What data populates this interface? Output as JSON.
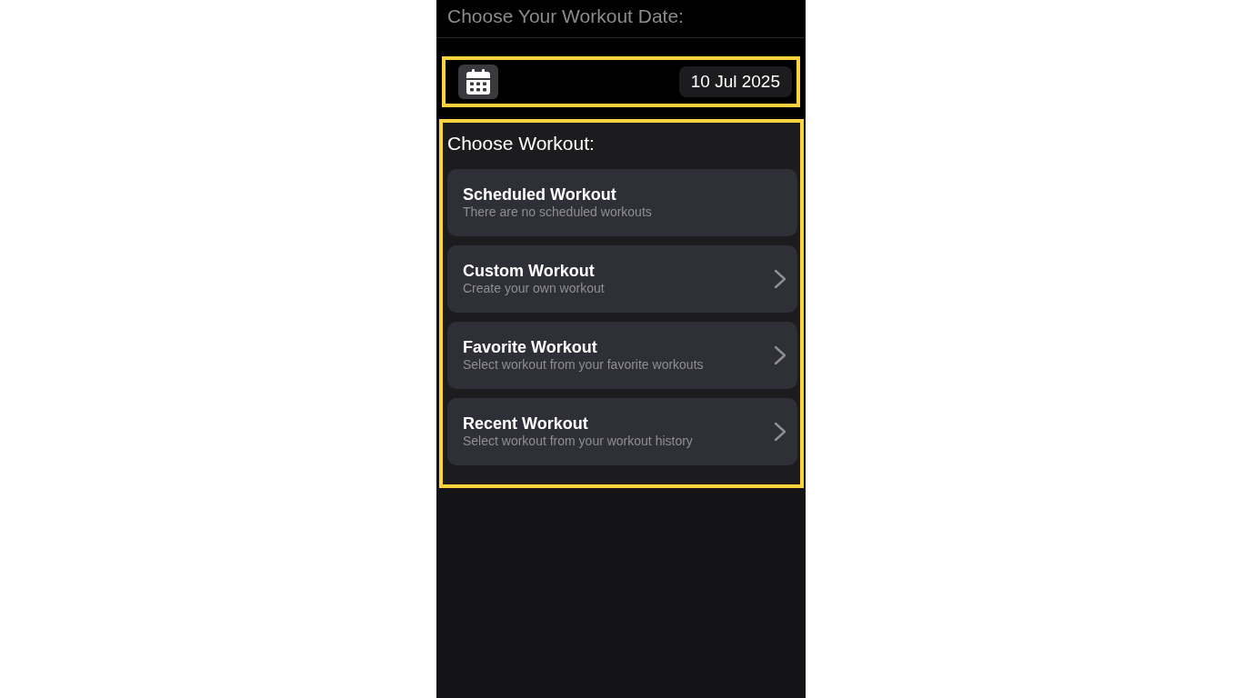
{
  "header": {
    "title": "Choose Your Workout Date:"
  },
  "date_picker": {
    "value": "10 Jul 2025"
  },
  "workout_section": {
    "title": "Choose Workout:",
    "options": [
      {
        "title": "Scheduled Workout",
        "subtitle": "There are no scheduled workouts",
        "chevron": false
      },
      {
        "title": "Custom Workout",
        "subtitle": "Create your own workout",
        "chevron": true
      },
      {
        "title": "Favorite Workout",
        "subtitle": "Select workout from your favorite workouts",
        "chevron": true
      },
      {
        "title": "Recent Workout",
        "subtitle": "Select workout from your workout history",
        "chevron": true
      }
    ]
  }
}
